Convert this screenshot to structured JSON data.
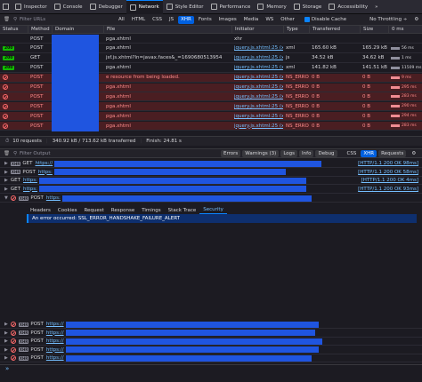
{
  "tabs": [
    {
      "label": "Inspector",
      "icon": "inspector-icon"
    },
    {
      "label": "Console",
      "icon": "console-icon"
    },
    {
      "label": "Debugger",
      "icon": "debugger-icon"
    },
    {
      "label": "Network",
      "icon": "network-icon"
    },
    {
      "label": "Style Editor",
      "icon": "style-editor-icon"
    },
    {
      "label": "Performance",
      "icon": "performance-icon"
    },
    {
      "label": "Memory",
      "icon": "memory-icon"
    },
    {
      "label": "Storage",
      "icon": "storage-icon"
    },
    {
      "label": "Accessibility",
      "icon": "accessibility-icon"
    }
  ],
  "filter": {
    "placeholder": "Filter URLs",
    "types": [
      "All",
      "HTML",
      "CSS",
      "JS",
      "XHR",
      "Fonts",
      "Images",
      "Media",
      "WS",
      "Other"
    ],
    "active_type": "XHR",
    "disable_cache": "Disable Cache",
    "throttling": "No Throttling ÷"
  },
  "columns": [
    "Status",
    "Method",
    "Domain",
    "File",
    "Initiator",
    "Type",
    "Transferred",
    "Size",
    "0 ms"
  ],
  "requests": [
    {
      "status": "",
      "method": "POST",
      "file": "pga.xhtml",
      "initiator": "xhr",
      "type": "",
      "transferred": "",
      "size": "",
      "timing": "",
      "error": false
    },
    {
      "status": "200",
      "method": "POST",
      "file": "pga.xhtml",
      "initiator": "jquery.js.xhtml:25 (x",
      "type": "xml",
      "transferred": "165.60 kB",
      "size": "165.29 kB",
      "timing": "56 ms",
      "error": false
    },
    {
      "status": "200",
      "method": "GET",
      "file": "jsf.js.xhtml?ln=javax.faces&_=1690680513954",
      "initiator": "jquery.js.xhtml:25 (x",
      "type": "js",
      "transferred": "34.52 kB",
      "size": "34.62 kB",
      "timing": "1 ms",
      "error": false
    },
    {
      "status": "200",
      "method": "POST",
      "file": "pga.xhtml",
      "initiator": "jquery.js.xhtml:25 (x",
      "type": "xml",
      "transferred": "141.82 kB",
      "size": "141.51 kB",
      "timing": "11509 ms",
      "error": false
    },
    {
      "status": "",
      "method": "POST",
      "file": "e resource from being loaded.",
      "initiator": "jquery.js.xhtml:25 (x",
      "type": "NS_ERROR_GENER...",
      "transferred": "0 B",
      "size": "0 B",
      "timing": "9 ms",
      "error": true
    },
    {
      "status": "",
      "method": "POST",
      "file": "pga.xhtml",
      "initiator": "jquery.js.xhtml:25 (x",
      "type": "NS_ERROR_GENER...",
      "transferred": "0 B",
      "size": "0 B",
      "timing": "295 ms",
      "error": true
    },
    {
      "status": "",
      "method": "POST",
      "file": "pga.xhtml",
      "initiator": "jquery.js.xhtml:25 (x",
      "type": "NS_ERROR_GENER...",
      "transferred": "0 B",
      "size": "0 B",
      "timing": "283 ms",
      "error": true
    },
    {
      "status": "",
      "method": "POST",
      "file": "pga.xhtml",
      "initiator": "jquery.js.xhtml:25 (x",
      "type": "NS_ERROR_GENER...",
      "transferred": "0 B",
      "size": "0 B",
      "timing": "290 ms",
      "error": true
    },
    {
      "status": "",
      "method": "POST",
      "file": "pga.xhtml",
      "initiator": "jquery.js.xhtml:25 (x",
      "type": "NS_ERROR_GENER...",
      "transferred": "0 B",
      "size": "0 B",
      "timing": "294 ms",
      "error": true
    },
    {
      "status": "",
      "method": "POST",
      "file": "pga.xhtml",
      "initiator": "jquery.js.xhtml:25 (x",
      "type": "NS_ERROR_GENER...",
      "transferred": "0 B",
      "size": "0 B",
      "timing": "283 ms",
      "error": true
    }
  ],
  "summary": {
    "requests": "10 requests",
    "transferred": "340.92 kB / 713.62 kB transferred",
    "finish": "Finish: 24.81 s"
  },
  "console_toolbar": {
    "placeholder": "Filter Output",
    "buttons": [
      "Errors",
      "Warnings (3)",
      "Logs",
      "Info",
      "Debug"
    ],
    "right": [
      "CSS",
      "XHR",
      "Requests"
    ]
  },
  "console_top": [
    {
      "method": "GET",
      "url": "https://",
      "status": "[HTTP/1.1 200 OK 98ms]",
      "badge": "XHR"
    },
    {
      "method": "POST",
      "url": "https:",
      "status": "[HTTP/1.1 200 OK 58ms]",
      "badge": "XHR"
    },
    {
      "method": "GET",
      "url": "https:",
      "status": "[HTTP/1.1 200 OK 4ms]",
      "badge": ""
    },
    {
      "method": "GET",
      "url": "https:",
      "status": "[HTTP/1.1 200 OK 93ms]",
      "badge": ""
    }
  ],
  "console_expanded": {
    "method": "POST",
    "url": "https:",
    "badge": "XHR"
  },
  "detail_tabs": [
    "Headers",
    "Cookies",
    "Request",
    "Response",
    "Timings",
    "Stack Trace",
    "Security"
  ],
  "detail_active": "Security",
  "detail_alert": "An error occurred: SSL_ERROR_HANDSHAKE_FAILURE_ALERT",
  "console_bottom": [
    {
      "method": "POST",
      "url": "https://",
      "badge": "XHR"
    },
    {
      "method": "POST",
      "url": "https://",
      "badge": "XHR"
    },
    {
      "method": "POST",
      "url": "https://",
      "badge": "XHR"
    },
    {
      "method": "POST",
      "url": "https://",
      "badge": "XHR"
    },
    {
      "method": "POST",
      "url": "https://",
      "badge": "XHR"
    }
  ],
  "prompt": "»"
}
